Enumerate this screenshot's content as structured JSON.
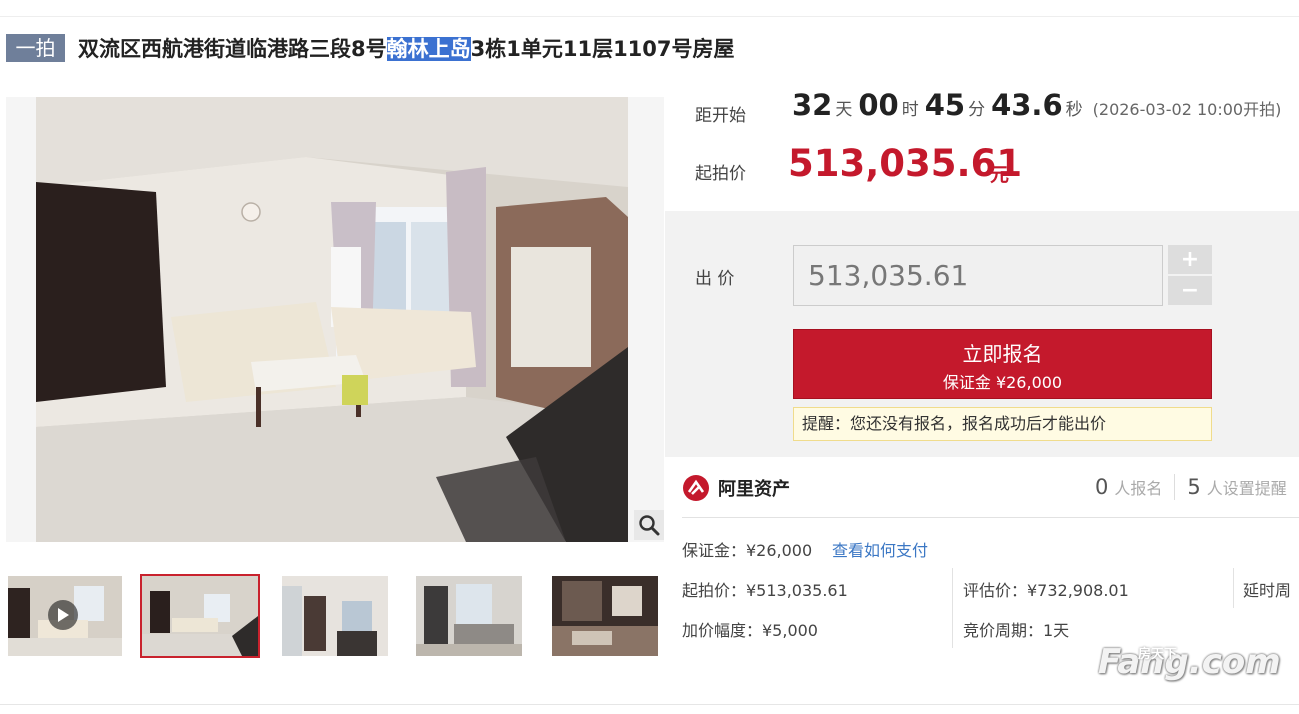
{
  "header": {
    "round_badge": "一拍",
    "title_prefix": "双流区西航港街道临港路三段8号",
    "title_highlight": "翰林上岛",
    "title_suffix": "3栋1单元11层1107号房屋"
  },
  "countdown": {
    "label": "距开始",
    "days": "32",
    "days_unit": "天",
    "hours": "00",
    "hours_unit": "时",
    "minutes": "45",
    "minutes_unit": "分",
    "seconds": "43.6",
    "seconds_unit": "秒",
    "start_time": "(2026-03-02 10:00开拍)"
  },
  "start_price": {
    "label": "起拍价",
    "value": "513,035.61",
    "unit": "元"
  },
  "bid": {
    "label": "出 价",
    "input_value": "513,035.61",
    "plus": "+",
    "minus": "−",
    "signup_label": "立即报名",
    "deposit_label": "保证金 ¥26,000",
    "tip": "提醒：您还没有报名，报名成功后才能出价"
  },
  "seller": {
    "name": "阿里资产",
    "signup_count": "0",
    "signup_text": "人报名",
    "reminder_count": "5",
    "reminder_text": "人设置提醒"
  },
  "details": {
    "deposit": "保证金：¥26,000",
    "how_to_pay": "查看如何支付",
    "start_price": "起拍价：¥513,035.61",
    "appraisal": "评估价：¥732,908.01",
    "delay": "延时周",
    "increment": "加价幅度：¥5,000",
    "period": "竞价周期：1天"
  },
  "watermark": {
    "brand": "Fang.com",
    "brand_cn": "房天下"
  },
  "colors": {
    "accent_red": "#c4192c",
    "badge_gray": "#6f7f9a",
    "highlight_blue": "#3b71d1",
    "link_blue": "#3b77c4"
  }
}
